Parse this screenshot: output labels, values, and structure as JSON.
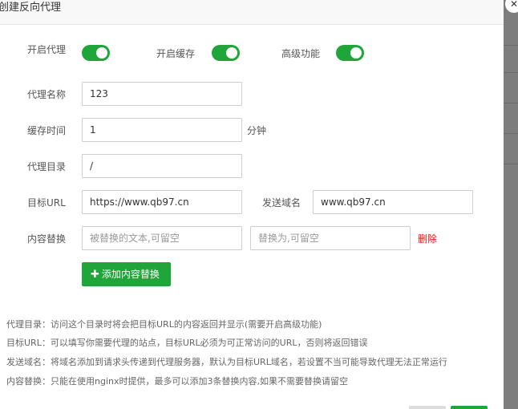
{
  "dialog": {
    "title": "创建反向代理",
    "close_icon": "close-icon"
  },
  "toggles": {
    "proxy": {
      "label": "开启代理",
      "on": true
    },
    "cache": {
      "label": "开启缓存",
      "on": true
    },
    "advanced": {
      "label": "高级功能",
      "on": true
    }
  },
  "form": {
    "proxy_name": {
      "label": "代理名称",
      "value": "123"
    },
    "cache_time": {
      "label": "缓存时间",
      "value": "1",
      "unit": "分钟"
    },
    "proxy_dir": {
      "label": "代理目录",
      "value": "/"
    },
    "target_url": {
      "label": "目标URL",
      "value": "https://www.qb97.cn"
    },
    "send_domain": {
      "label": "发送域名",
      "value": "www.qb97.cn"
    },
    "replace": {
      "label": "内容替换",
      "from_placeholder": "被替换的文本,可留空",
      "to_placeholder": "替换为,可留空",
      "delete_label": "删除"
    },
    "add_replace_label": "添加内容替换"
  },
  "help": [
    "代理目录：访问这个目录时将会把目标URL的内容返回并显示(需要开启高级功能)",
    "目标URL：可以填写你需要代理的站点，目标URL必须为可正常访问的URL，否则将返回错误",
    "发送域名：将域名添加到请求头传递到代理服务器，默认为目标URL域名，若设置不当可能导致代理无法正常运行",
    "内容替换：只能在使用nginx时提供，最多可以添加3条替换内容,如果不需要替换请留空"
  ],
  "colors": {
    "accent": "#20a53a",
    "danger": "#ee1111"
  }
}
